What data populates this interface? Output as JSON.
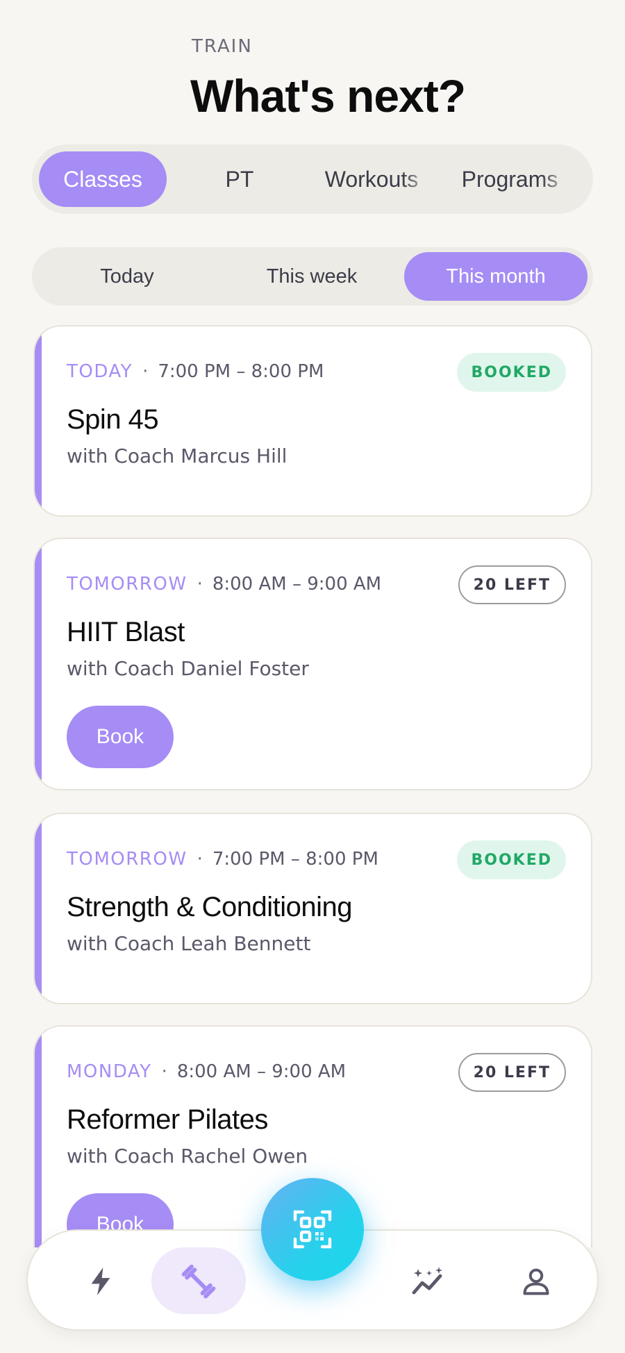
{
  "header": {
    "eyebrow": "TRAIN",
    "title": "What's next?"
  },
  "main_tabs": [
    {
      "label": "Classes",
      "active": true
    },
    {
      "label": "PT",
      "active": false
    },
    {
      "label": "Workouts",
      "active": false
    },
    {
      "label": "Programs",
      "active": false
    }
  ],
  "range_tabs": [
    {
      "label": "Today",
      "active": false
    },
    {
      "label": "This week",
      "active": false
    },
    {
      "label": "This month",
      "active": true
    }
  ],
  "classes": [
    {
      "day": "TODAY",
      "time": "7:00 PM – 8:00 PM",
      "title": "Spin 45",
      "coach": "with Coach Marcus Hill",
      "badge": "BOOKED",
      "badge_type": "booked",
      "book_label": ""
    },
    {
      "day": "TOMORROW",
      "time": "8:00 AM – 9:00 AM",
      "title": "HIIT Blast",
      "coach": "with Coach Daniel Foster",
      "badge": "20 LEFT",
      "badge_type": "left",
      "book_label": "Book"
    },
    {
      "day": "TOMORROW",
      "time": "7:00 PM – 8:00 PM",
      "title": "Strength & Conditioning",
      "coach": "with Coach Leah Bennett",
      "badge": "BOOKED",
      "badge_type": "booked",
      "book_label": ""
    },
    {
      "day": "MONDAY",
      "time": "8:00 AM – 9:00 AM",
      "title": "Reformer Pilates",
      "coach": "with Coach Rachel Owen",
      "badge": "20 LEFT",
      "badge_type": "left",
      "book_label": "Book"
    }
  ],
  "nav": {
    "items": [
      {
        "icon": "lightning-icon",
        "active": false
      },
      {
        "icon": "dumbbell-icon",
        "active": true
      },
      {
        "icon": "progress-sparkle-icon",
        "active": false
      },
      {
        "icon": "profile-icon",
        "active": false
      }
    ],
    "fab_icon": "qr-scan-icon"
  },
  "colors": {
    "accent": "#a68cf5",
    "booked_bg": "#e0f6ec",
    "booked_text": "#21a866",
    "fab": "#28d0ec",
    "background": "#f7f6f2"
  }
}
